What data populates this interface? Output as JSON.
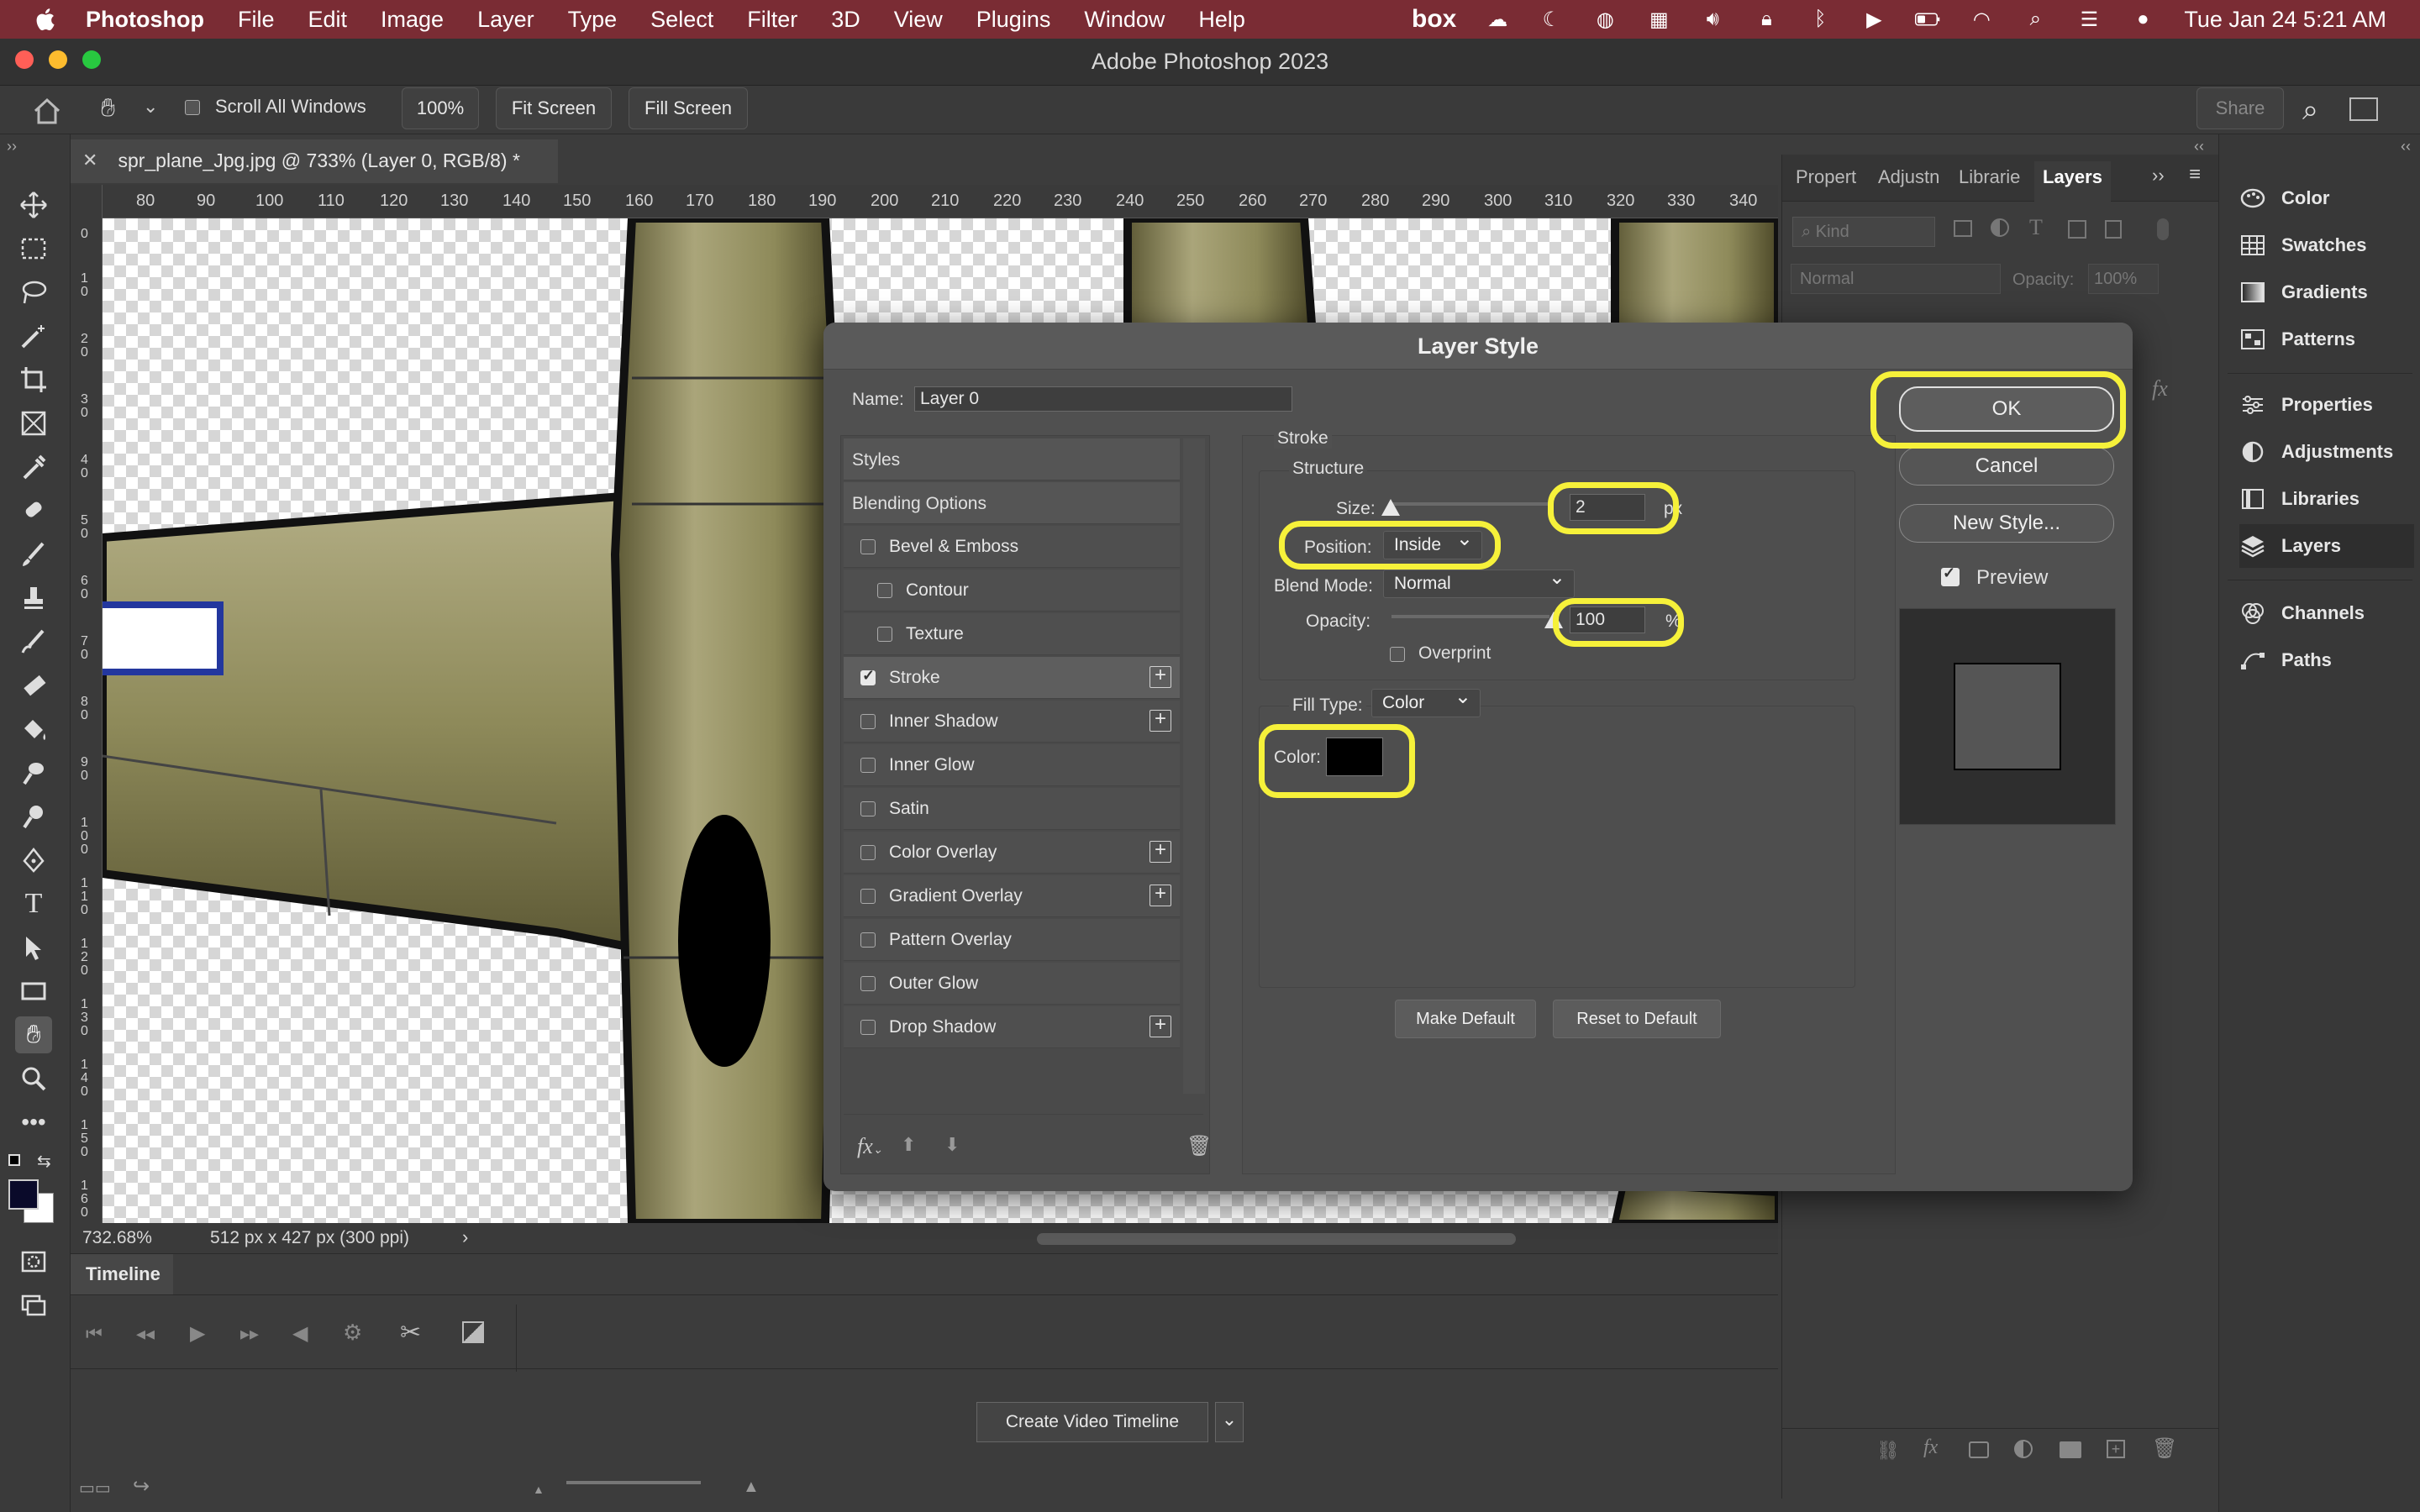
{
  "menubar": {
    "app_name": "Photoshop",
    "items": [
      "File",
      "Edit",
      "Image",
      "Layer",
      "Type",
      "Select",
      "Filter",
      "3D",
      "View",
      "Plugins",
      "Window",
      "Help"
    ],
    "box_label": "box",
    "datetime": "Tue Jan 24  5:21 AM"
  },
  "window": {
    "title": "Adobe Photoshop 2023"
  },
  "options_bar": {
    "scroll_all_windows": "Scroll All Windows",
    "zoom_value": "100%",
    "fit_screen": "Fit Screen",
    "fill_screen": "Fill Screen",
    "share": "Share"
  },
  "document": {
    "tab_title": "spr_plane_Jpg.jpg @ 733% (Layer 0, RGB/8) *",
    "ruler_h": [
      "80",
      "90",
      "100",
      "110",
      "120",
      "130",
      "140",
      "150",
      "160",
      "170",
      "180",
      "190",
      "200",
      "210",
      "220",
      "230",
      "240",
      "250",
      "260",
      "270",
      "280",
      "290",
      "300",
      "310",
      "320",
      "330",
      "340"
    ],
    "ruler_v": [
      "0",
      "1 0",
      "2 0",
      "3 0",
      "4 0",
      "5 0",
      "6 0",
      "7 0",
      "8 0",
      "9 0",
      "1 0 0",
      "1 1 0",
      "1 2 0",
      "1 3 0",
      "1 4 0",
      "1 5 0",
      "1 6 0"
    ]
  },
  "status": {
    "zoom": "732.68%",
    "info": "512 px x 427 px (300 ppi)"
  },
  "timeline": {
    "title": "Timeline",
    "create_button": "Create Video Timeline"
  },
  "layers_panel": {
    "tabs": [
      "Propert",
      "Adjustn",
      "Librarie",
      "Layers"
    ],
    "kind": "Kind",
    "blend": "Normal",
    "opacity_label": "Opacity:",
    "opacity_value": "100%"
  },
  "dock": {
    "items": [
      "Color",
      "Swatches",
      "Gradients",
      "Patterns",
      "Properties",
      "Adjustments",
      "Libraries",
      "Layers",
      "Channels",
      "Paths"
    ]
  },
  "dialog": {
    "title": "Layer Style",
    "name_label": "Name:",
    "name_value": "Layer 0",
    "styles_header": "Styles",
    "blending_options": "Blending Options",
    "styles": [
      {
        "label": "Bevel & Emboss",
        "checked": false,
        "plus": false
      },
      {
        "label": "Contour",
        "checked": false,
        "plus": false
      },
      {
        "label": "Texture",
        "checked": false,
        "plus": false
      },
      {
        "label": "Stroke",
        "checked": true,
        "plus": true
      },
      {
        "label": "Inner Shadow",
        "checked": false,
        "plus": true
      },
      {
        "label": "Inner Glow",
        "checked": false,
        "plus": false
      },
      {
        "label": "Satin",
        "checked": false,
        "plus": false
      },
      {
        "label": "Color Overlay",
        "checked": false,
        "plus": true
      },
      {
        "label": "Gradient Overlay",
        "checked": false,
        "plus": true
      },
      {
        "label": "Pattern Overlay",
        "checked": false,
        "plus": false
      },
      {
        "label": "Outer Glow",
        "checked": false,
        "plus": false
      },
      {
        "label": "Drop Shadow",
        "checked": false,
        "plus": true
      }
    ],
    "stroke": {
      "section": "Stroke",
      "structure": "Structure",
      "size_label": "Size:",
      "size_value": "2",
      "size_unit": "px",
      "position_label": "Position:",
      "position_value": "Inside",
      "blend_label": "Blend Mode:",
      "blend_value": "Normal",
      "opacity_label": "Opacity:",
      "opacity_value": "100",
      "opacity_unit": "%",
      "overprint": "Overprint",
      "fill_type_label": "Fill Type:",
      "fill_type_value": "Color",
      "color_label": "Color:",
      "color_value": "#000000"
    },
    "make_default": "Make Default",
    "reset_default": "Reset to Default",
    "ok": "OK",
    "cancel": "Cancel",
    "new_style": "New Style...",
    "preview": "Preview",
    "preview_checked": true
  },
  "colors": {
    "menubar_bg": "#7a2c34",
    "highlight": "#f6f13a",
    "plane_body": "#8e8a5a"
  }
}
